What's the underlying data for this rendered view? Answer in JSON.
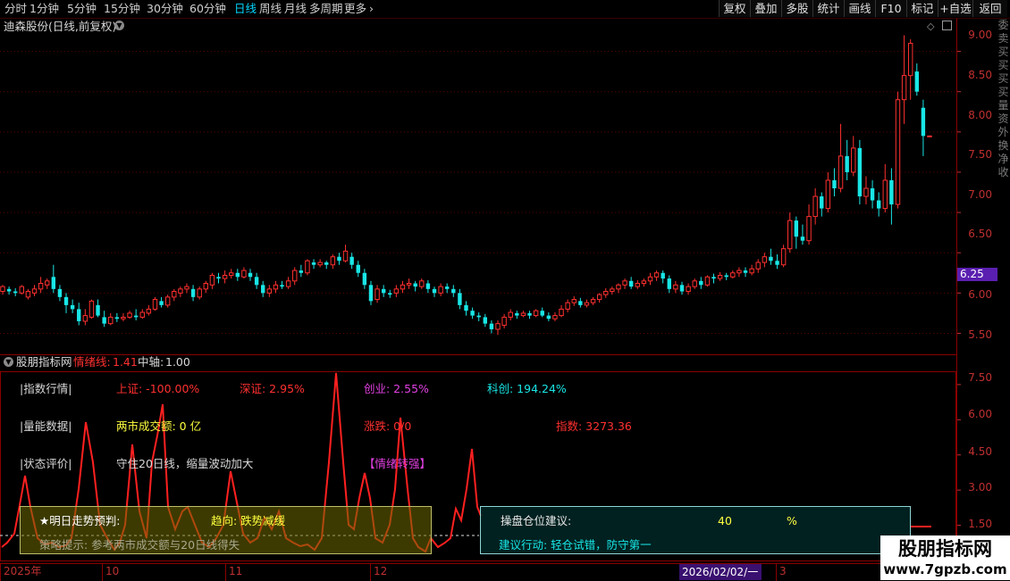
{
  "toolbar": {
    "periods": [
      "分时",
      "1分钟",
      "5分钟",
      "15分钟",
      "30分钟",
      "60分钟",
      "日线",
      "周线",
      "月线",
      "多周期",
      "更多"
    ],
    "active_period": "日线",
    "right_buttons": [
      "复权",
      "叠加",
      "多股",
      "统计",
      "画线",
      "F10",
      "标记",
      "+自选",
      "返回"
    ]
  },
  "stock": {
    "title": "迪森股份(日线,前复权)"
  },
  "price_axis": {
    "labels": [
      "9.00",
      "8.50",
      "8.00",
      "7.50",
      "7.00",
      "6.50",
      "6.00",
      "5.50"
    ],
    "current_price": "6.25"
  },
  "indicator": {
    "name": "股朋指标网",
    "mood_label": "情绪线:",
    "mood_value": "1.41",
    "axis_label": "中轴:",
    "axis_value": "1.00",
    "axis_labels": [
      "7.50",
      "6.00",
      "4.50",
      "3.00",
      "1.50"
    ]
  },
  "info": {
    "row1": {
      "label": "|指数行情|",
      "sh": "上证: -100.00%",
      "sz": "深证: 2.95%",
      "cy": "创业: 2.55%",
      "kc": "科创: 194.24%"
    },
    "row2": {
      "label": "|量能数据|",
      "turnover": "两市成交额: 0 亿",
      "updown": "涨跌: 0/0",
      "index": "指数: 3273.36"
    },
    "row3": {
      "label": "|状态评价|",
      "desc": "守住20日线，缩量波动加大",
      "tag": "【情绪转强】"
    },
    "forecast": {
      "label": "★明日走势预判:",
      "value": "趋向: 跌势减缓",
      "tip": "策略提示: 参考两市成交额与20日线得失"
    },
    "position": {
      "label": "操盘仓位建议:",
      "value": "40",
      "unit": "%",
      "action": "建议行动: 轻仓试错，防守第一"
    }
  },
  "date_axis": {
    "labels": [
      "2025年",
      "10",
      "11",
      "12",
      "2026/02/02/一",
      "3"
    ]
  },
  "side_strip": {
    "chars": [
      "委",
      "卖",
      "买",
      "买",
      "买",
      "买",
      "量",
      "资",
      "外",
      "换",
      "净",
      "收"
    ]
  },
  "watermark": {
    "name": "股朋指标网",
    "url": "www.7gpzb.com"
  },
  "colors": {
    "up": "#ff3030",
    "down": "#19e6e6",
    "frame": "#8a0000",
    "active": "#00d8ff",
    "price_tag": "#5a1fb0"
  },
  "chart_data": {
    "type": "candlestick",
    "price_range": [
      5.35,
      9.25
    ],
    "price_ticks": [
      5.5,
      6.0,
      6.5,
      7.0,
      7.5,
      8.0,
      8.5,
      9.0
    ],
    "candles": [
      [
        6.02,
        6.08,
        5.98,
        6.1
      ],
      [
        6.05,
        6.02,
        5.98,
        6.08
      ],
      [
        6.02,
        6.0,
        5.96,
        6.06
      ],
      [
        6.0,
        6.08,
        5.98,
        6.1
      ],
      [
        5.95,
        6.02,
        5.92,
        6.05
      ],
      [
        6.0,
        6.05,
        5.96,
        6.1
      ],
      [
        6.05,
        6.12,
        6.0,
        6.2
      ],
      [
        6.1,
        6.15,
        6.05,
        6.18
      ],
      [
        6.2,
        6.05,
        6.0,
        6.35
      ],
      [
        6.05,
        5.95,
        5.9,
        6.1
      ],
      [
        5.95,
        5.85,
        5.75,
        6.0
      ],
      [
        5.85,
        5.8,
        5.75,
        5.92
      ],
      [
        5.8,
        5.65,
        5.6,
        5.88
      ],
      [
        5.65,
        5.72,
        5.6,
        5.8
      ],
      [
        5.7,
        5.9,
        5.68,
        5.92
      ],
      [
        5.85,
        5.72,
        5.7,
        5.92
      ],
      [
        5.7,
        5.62,
        5.58,
        5.78
      ],
      [
        5.62,
        5.7,
        5.6,
        5.75
      ],
      [
        5.7,
        5.68,
        5.64,
        5.75
      ],
      [
        5.68,
        5.7,
        5.65,
        5.75
      ],
      [
        5.7,
        5.75,
        5.68,
        5.78
      ],
      [
        5.72,
        5.7,
        5.66,
        5.8
      ],
      [
        5.7,
        5.76,
        5.68,
        5.8
      ],
      [
        5.75,
        5.8,
        5.72,
        5.85
      ],
      [
        5.8,
        5.92,
        5.78,
        5.95
      ],
      [
        5.9,
        5.85,
        5.82,
        5.95
      ],
      [
        5.85,
        5.95,
        5.82,
        5.98
      ],
      [
        5.95,
        6.02,
        5.9,
        6.05
      ],
      [
        6.0,
        6.05,
        5.95,
        6.08
      ],
      [
        6.05,
        6.08,
        6.0,
        6.12
      ],
      [
        6.05,
        5.95,
        5.9,
        6.1
      ],
      [
        5.95,
        6.05,
        5.92,
        6.08
      ],
      [
        6.05,
        6.12,
        6.0,
        6.15
      ],
      [
        6.1,
        6.22,
        6.05,
        6.25
      ],
      [
        6.2,
        6.18,
        6.12,
        6.25
      ],
      [
        6.18,
        6.22,
        6.12,
        6.28
      ],
      [
        6.22,
        6.25,
        6.18,
        6.3
      ],
      [
        6.25,
        6.2,
        6.15,
        6.3
      ],
      [
        6.2,
        6.28,
        6.18,
        6.32
      ],
      [
        6.25,
        6.2,
        6.15,
        6.3
      ],
      [
        6.2,
        6.1,
        6.05,
        6.25
      ],
      [
        6.1,
        6.0,
        5.95,
        6.15
      ],
      [
        6.0,
        6.05,
        5.95,
        6.1
      ],
      [
        6.05,
        6.1,
        6.0,
        6.15
      ],
      [
        6.1,
        6.08,
        6.05,
        6.15
      ],
      [
        6.08,
        6.15,
        6.05,
        6.2
      ],
      [
        6.15,
        6.28,
        6.1,
        6.32
      ],
      [
        6.28,
        6.25,
        6.2,
        6.35
      ],
      [
        6.25,
        6.4,
        6.22,
        6.42
      ],
      [
        6.38,
        6.35,
        6.3,
        6.42
      ],
      [
        6.35,
        6.38,
        6.32,
        6.42
      ],
      [
        6.38,
        6.35,
        6.3,
        6.4
      ],
      [
        6.35,
        6.45,
        6.3,
        6.48
      ],
      [
        6.45,
        6.4,
        6.35,
        6.5
      ],
      [
        6.4,
        6.52,
        6.38,
        6.6
      ],
      [
        6.45,
        6.35,
        6.3,
        6.5
      ],
      [
        6.35,
        6.25,
        6.2,
        6.4
      ],
      [
        6.25,
        6.1,
        6.05,
        6.3
      ],
      [
        6.1,
        5.9,
        5.85,
        6.15
      ],
      [
        5.92,
        6.05,
        5.88,
        6.1
      ],
      [
        6.05,
        6.0,
        5.95,
        6.1
      ],
      [
        6.0,
        5.98,
        5.94,
        6.04
      ],
      [
        6.0,
        6.05,
        5.95,
        6.1
      ],
      [
        6.05,
        6.1,
        6.0,
        6.15
      ],
      [
        6.1,
        6.12,
        6.05,
        6.18
      ],
      [
        6.12,
        6.08,
        6.02,
        6.15
      ],
      [
        6.08,
        6.15,
        6.05,
        6.18
      ],
      [
        6.12,
        6.05,
        6.0,
        6.16
      ],
      [
        6.05,
        6.0,
        5.95,
        6.08
      ],
      [
        6.0,
        6.08,
        5.96,
        6.12
      ],
      [
        6.08,
        6.05,
        6.0,
        6.12
      ],
      [
        6.05,
        6.0,
        5.95,
        6.1
      ],
      [
        6.0,
        5.85,
        5.8,
        6.05
      ],
      [
        5.85,
        5.78,
        5.72,
        5.9
      ],
      [
        5.78,
        5.72,
        5.68,
        5.82
      ],
      [
        5.72,
        5.7,
        5.65,
        5.76
      ],
      [
        5.7,
        5.62,
        5.58,
        5.74
      ],
      [
        5.62,
        5.55,
        5.5,
        5.66
      ],
      [
        5.55,
        5.62,
        5.48,
        5.66
      ],
      [
        5.6,
        5.7,
        5.56,
        5.74
      ],
      [
        5.7,
        5.76,
        5.66,
        5.8
      ],
      [
        5.75,
        5.72,
        5.68,
        5.78
      ],
      [
        5.72,
        5.75,
        5.7,
        5.78
      ],
      [
        5.75,
        5.72,
        5.68,
        5.78
      ],
      [
        5.72,
        5.78,
        5.7,
        5.8
      ],
      [
        5.78,
        5.72,
        5.7,
        5.82
      ],
      [
        5.72,
        5.68,
        5.65,
        5.76
      ],
      [
        5.68,
        5.72,
        5.65,
        5.76
      ],
      [
        5.72,
        5.8,
        5.7,
        5.85
      ],
      [
        5.8,
        5.88,
        5.76,
        5.92
      ],
      [
        5.88,
        5.92,
        5.84,
        5.96
      ],
      [
        5.9,
        5.85,
        5.82,
        5.94
      ],
      [
        5.85,
        5.88,
        5.82,
        5.92
      ],
      [
        5.88,
        5.92,
        5.85,
        5.95
      ],
      [
        5.92,
        5.98,
        5.88,
        6.0
      ],
      [
        5.98,
        6.02,
        5.94,
        6.06
      ],
      [
        6.02,
        6.05,
        5.98,
        6.08
      ],
      [
        6.05,
        6.1,
        6.0,
        6.12
      ],
      [
        6.1,
        6.15,
        6.05,
        6.18
      ],
      [
        6.15,
        6.08,
        6.05,
        6.2
      ],
      [
        6.08,
        6.12,
        6.05,
        6.16
      ],
      [
        6.12,
        6.15,
        6.08,
        6.18
      ],
      [
        6.15,
        6.2,
        6.1,
        6.25
      ],
      [
        6.2,
        6.25,
        6.15,
        6.28
      ],
      [
        6.25,
        6.18,
        6.12,
        6.28
      ],
      [
        6.18,
        6.05,
        6.0,
        6.22
      ],
      [
        6.05,
        6.1,
        6.0,
        6.15
      ],
      [
        6.1,
        6.02,
        5.98,
        6.14
      ],
      [
        6.02,
        6.08,
        5.98,
        6.12
      ],
      [
        6.08,
        6.15,
        6.05,
        6.18
      ],
      [
        6.15,
        6.1,
        6.05,
        6.2
      ],
      [
        6.1,
        6.2,
        6.08,
        6.22
      ],
      [
        6.2,
        6.18,
        6.12,
        6.24
      ],
      [
        6.18,
        6.22,
        6.15,
        6.26
      ],
      [
        6.22,
        6.2,
        6.16,
        6.25
      ],
      [
        6.2,
        6.25,
        6.18,
        6.28
      ],
      [
        6.25,
        6.28,
        6.2,
        6.32
      ],
      [
        6.28,
        6.25,
        6.2,
        6.32
      ],
      [
        6.25,
        6.3,
        6.22,
        6.35
      ],
      [
        6.3,
        6.38,
        6.25,
        6.42
      ],
      [
        6.38,
        6.45,
        6.32,
        6.5
      ],
      [
        6.45,
        6.4,
        6.35,
        6.55
      ],
      [
        6.4,
        6.35,
        6.3,
        6.48
      ],
      [
        6.35,
        6.55,
        6.32,
        6.6
      ],
      [
        6.55,
        6.9,
        6.5,
        7.0
      ],
      [
        6.9,
        6.7,
        6.55,
        6.95
      ],
      [
        6.7,
        6.65,
        6.6,
        6.85
      ],
      [
        6.65,
        6.95,
        6.6,
        7.1
      ],
      [
        6.95,
        7.2,
        6.85,
        7.3
      ],
      [
        7.2,
        7.05,
        6.95,
        7.25
      ],
      [
        7.05,
        7.4,
        7.0,
        7.5
      ],
      [
        7.4,
        7.3,
        7.2,
        7.55
      ],
      [
        7.3,
        7.7,
        7.25,
        8.1
      ],
      [
        7.7,
        7.5,
        7.4,
        7.9
      ],
      [
        7.5,
        7.8,
        7.45,
        7.95
      ],
      [
        7.8,
        7.2,
        7.1,
        7.9
      ],
      [
        7.2,
        7.3,
        7.1,
        7.45
      ],
      [
        7.3,
        7.15,
        7.05,
        7.4
      ],
      [
        7.15,
        7.05,
        6.95,
        7.25
      ],
      [
        7.05,
        7.4,
        7.0,
        7.6
      ],
      [
        7.4,
        7.1,
        6.85,
        7.55
      ],
      [
        7.1,
        8.4,
        7.05,
        8.5
      ],
      [
        8.4,
        8.7,
        8.1,
        9.2
      ],
      [
        8.7,
        9.1,
        8.4,
        9.15
      ],
      [
        8.75,
        8.5,
        8.45,
        8.85
      ],
      [
        8.3,
        7.95,
        7.7,
        8.4
      ],
      [
        7.95,
        7.95,
        7.95,
        7.95
      ]
    ]
  }
}
